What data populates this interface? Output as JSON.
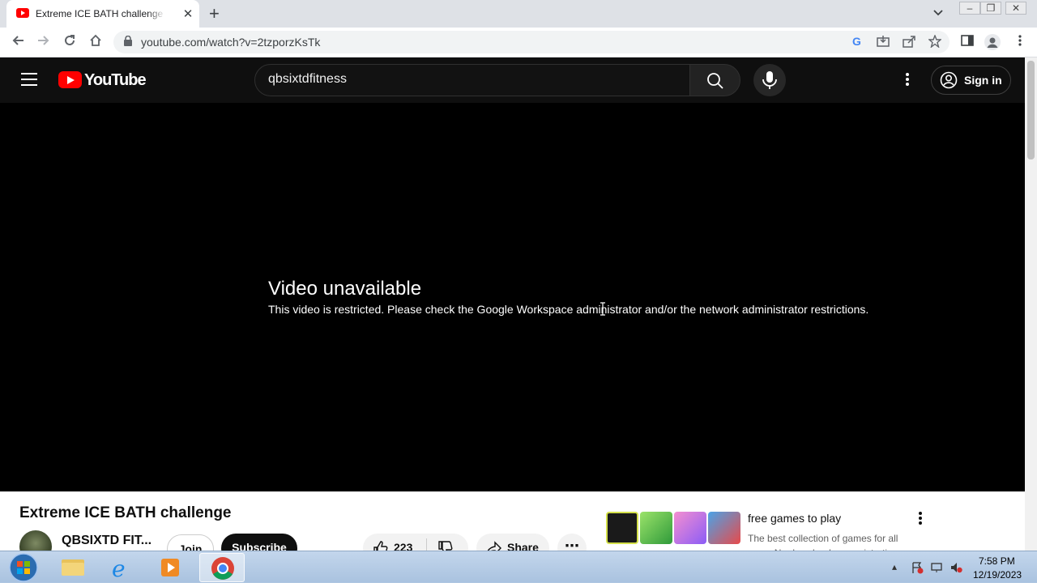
{
  "browser": {
    "tab_title": "Extreme ICE BATH challenge - YouTube",
    "new_tab": "+",
    "tab_close": "✕",
    "url": "youtube.com/watch?v=2tzporzKsTk"
  },
  "youtube": {
    "logo_text": "YouTube",
    "search_value": "qbsixtdfitness",
    "sign_in": "Sign in"
  },
  "player": {
    "error_title": "Video unavailable",
    "error_message": "This video is restricted. Please check the Google Workspace administrator and/or the network administrator restrictions."
  },
  "video": {
    "title": "Extreme ICE BATH challenge",
    "channel": "QBSIXTD FIT...",
    "join_label": "Join",
    "subscribe_label": "Subscribe",
    "like_count": "223",
    "share_label": "Share",
    "more_label": "⋯"
  },
  "ad": {
    "title": "free games to play",
    "description": "The best collection of games for all ages. No downloads or registration"
  },
  "taskbar": {
    "time": "7:58 PM",
    "date": "12/19/2023"
  }
}
